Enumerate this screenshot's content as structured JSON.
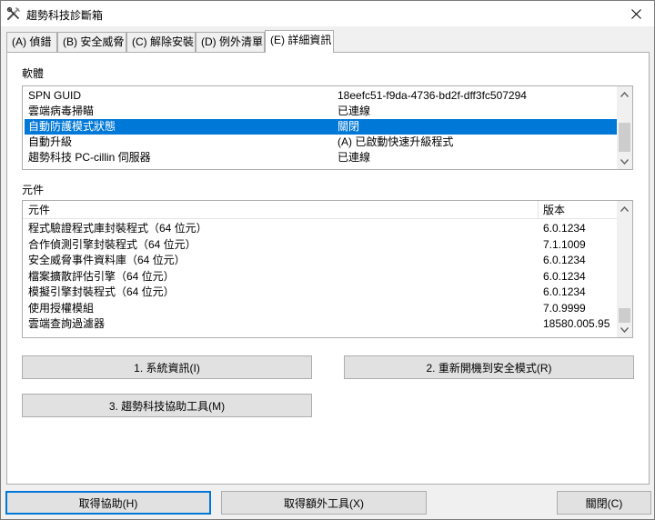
{
  "window": {
    "title": "趨勢科技診斷箱"
  },
  "tabs": [
    {
      "label": "(A) 偵錯"
    },
    {
      "label": "(B) 安全威脅"
    },
    {
      "label": "(C) 解除安裝"
    },
    {
      "label": "(D) 例外清單"
    },
    {
      "label": "(E) 詳細資訊"
    }
  ],
  "software": {
    "label": "軟體",
    "rows": [
      {
        "name": "SPN GUID",
        "value": "18eefc51-f9da-4736-bd2f-dff3fc507294"
      },
      {
        "name": "雲端病毒掃瞄",
        "value": "已連線"
      },
      {
        "name": "自動防護模式狀態",
        "value": "關閉"
      },
      {
        "name": "自動升級",
        "value": "(A) 已啟動快速升級程式"
      },
      {
        "name": "趨勢科技 PC-cillin 伺服器",
        "value": "已連線"
      }
    ],
    "selected_index": 2
  },
  "components": {
    "label": "元件",
    "headers": {
      "name": "元件",
      "version": "版本"
    },
    "rows": [
      {
        "name": "程式驗證程式庫封裝程式（64 位元）",
        "version": "6.0.1234"
      },
      {
        "name": "合作偵測引擎封裝程式（64 位元）",
        "version": "7.1.1009"
      },
      {
        "name": "安全威脅事件資料庫（64 位元）",
        "version": "6.0.1234"
      },
      {
        "name": "檔案擴散評估引擎（64 位元）",
        "version": "6.0.1234"
      },
      {
        "name": "模擬引擎封裝程式（64 位元）",
        "version": "6.0.1234"
      },
      {
        "name": "使用授權模組",
        "version": "7.0.9999"
      },
      {
        "name": "雲端查詢過濾器",
        "version": "18580.005.95"
      }
    ]
  },
  "buttons": {
    "system_info": "1. 系統資訊(I)",
    "safe_mode": "2. 重新開機到安全模式(R)",
    "assist_tool": "3. 趨勢科技協助工具(M)",
    "get_help": "取得協助(H)",
    "extra_tools": "取得額外工具(X)",
    "close": "關閉(C)"
  },
  "colors": {
    "selection": "#0078d7",
    "default_button_border": "#0078d7"
  },
  "icons": {
    "app": "tools-icon",
    "close": "close-icon"
  }
}
